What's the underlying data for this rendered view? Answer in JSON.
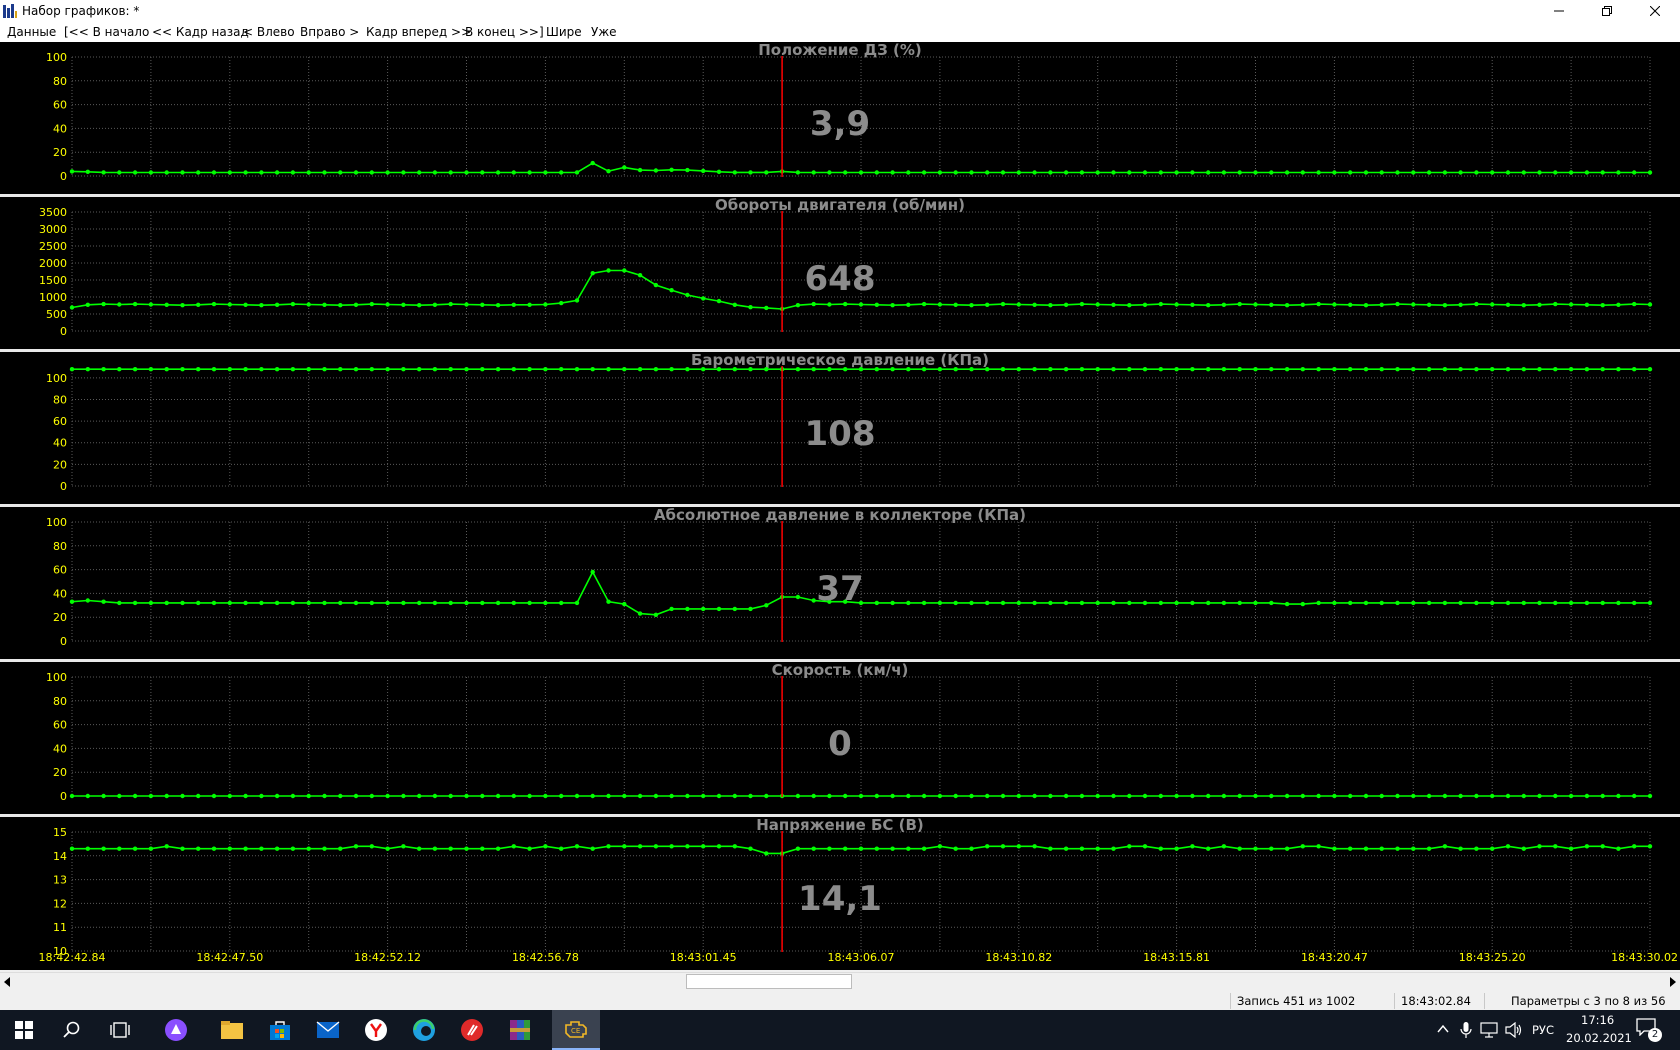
{
  "window": {
    "title": "Набор графиков: *",
    "controls": [
      "minimize",
      "restore",
      "close"
    ]
  },
  "menu": {
    "items": [
      "Данные",
      "[<< В начало",
      "<< Кадр назад",
      "< Влево",
      "Вправо >",
      "Кадр вперед >>",
      "В конец >>]",
      "Шире",
      "Уже"
    ]
  },
  "colors": {
    "background": "#000000",
    "grid": "#5a5a5a",
    "series": "#00ff00",
    "axis_labels": "#ffff00",
    "cursor": "#ff0000",
    "titles": "#8c8c8c",
    "value_readout": "#8c8c8c",
    "separator": "#e8e8e8"
  },
  "cursor_index": 45,
  "chart_data": [
    {
      "type": "line",
      "title": "Положение ДЗ  (%)",
      "current_value": "3,9",
      "ylim": [
        0,
        100
      ],
      "yticks": [
        "0",
        "20",
        "40",
        "60",
        "80",
        "100"
      ],
      "grid": true,
      "x": [
        0,
        1,
        2,
        3,
        4,
        5,
        6,
        7,
        8,
        9,
        10,
        11,
        12,
        13,
        14,
        15,
        16,
        17,
        18,
        19,
        20,
        21,
        22,
        23,
        24,
        25,
        26,
        27,
        28,
        29,
        30,
        31,
        32,
        33,
        34,
        35,
        36,
        37,
        38,
        39,
        40,
        41,
        42,
        43,
        44,
        45,
        46,
        47,
        48,
        49,
        50,
        51,
        52,
        53,
        54,
        55,
        56,
        57,
        58,
        59,
        60,
        61,
        62,
        63,
        64,
        65,
        66,
        67,
        68,
        69,
        70,
        71,
        72,
        73,
        74,
        75,
        76,
        77,
        78,
        79,
        80,
        81,
        82,
        83,
        84,
        85,
        86,
        87,
        88,
        89,
        90,
        91,
        92,
        93,
        94,
        95,
        96,
        97,
        98,
        99,
        100
      ],
      "values": [
        3.9,
        3.5,
        3.0,
        2.9,
        2.9,
        2.9,
        2.9,
        2.9,
        2.9,
        2.9,
        2.9,
        2.9,
        2.9,
        2.9,
        2.9,
        2.9,
        2.9,
        2.9,
        2.9,
        2.9,
        2.9,
        2.9,
        2.9,
        2.9,
        2.9,
        2.9,
        2.9,
        2.9,
        2.9,
        2.9,
        2.9,
        2.9,
        3.0,
        10.8,
        4.0,
        7.2,
        5.0,
        4.6,
        5.2,
        5.0,
        4.3,
        3.5,
        3.0,
        3.0,
        3.0,
        3.9,
        3.0,
        2.9,
        2.9,
        2.9,
        2.9,
        2.9,
        2.9,
        2.9,
        2.9,
        2.9,
        2.9,
        2.9,
        2.9,
        2.9,
        2.9,
        2.9,
        2.9,
        2.9,
        2.9,
        2.9,
        2.9,
        2.9,
        2.9,
        2.9,
        2.9,
        2.9,
        2.9,
        2.9,
        2.9,
        2.9,
        2.9,
        2.9,
        2.9,
        2.9,
        2.9,
        2.9,
        2.9,
        2.9,
        2.9,
        2.9,
        2.9,
        2.9,
        2.9,
        2.9,
        2.9,
        2.9,
        2.9,
        2.9,
        2.9,
        2.9,
        2.9,
        2.9,
        2.9,
        2.9,
        2.9
      ]
    },
    {
      "type": "line",
      "title": "Обороты двигателя  (об/мин)",
      "current_value": "648",
      "ylim": [
        0,
        3500
      ],
      "yticks": [
        "0",
        "500",
        "1000",
        "1500",
        "2000",
        "2500",
        "3000",
        "3500"
      ],
      "grid": true,
      "x": [
        0,
        1,
        2,
        3,
        4,
        5,
        6,
        7,
        8,
        9,
        10,
        11,
        12,
        13,
        14,
        15,
        16,
        17,
        18,
        19,
        20,
        21,
        22,
        23,
        24,
        25,
        26,
        27,
        28,
        29,
        30,
        31,
        32,
        33,
        34,
        35,
        36,
        37,
        38,
        39,
        40,
        41,
        42,
        43,
        44,
        45,
        46,
        47,
        48,
        49,
        50,
        51,
        52,
        53,
        54,
        55,
        56,
        57,
        58,
        59,
        60,
        61,
        62,
        63,
        64,
        65,
        66,
        67,
        68,
        69,
        70,
        71,
        72,
        73,
        74,
        75,
        76,
        77,
        78,
        79,
        80,
        81,
        82,
        83,
        84,
        85,
        86,
        87,
        88,
        89,
        90,
        91,
        92,
        93,
        94,
        95,
        96,
        97,
        98,
        99,
        100
      ],
      "values": [
        690,
        770,
        790,
        780,
        790,
        780,
        770,
        760,
        770,
        790,
        780,
        770,
        760,
        770,
        790,
        780,
        770,
        760,
        770,
        790,
        780,
        770,
        760,
        770,
        790,
        780,
        770,
        760,
        770,
        770,
        780,
        820,
        900,
        1700,
        1780,
        1780,
        1640,
        1350,
        1200,
        1060,
        960,
        880,
        770,
        700,
        680,
        648,
        760,
        790,
        780,
        790,
        780,
        770,
        760,
        770,
        790,
        780,
        770,
        760,
        770,
        790,
        780,
        770,
        760,
        770,
        790,
        780,
        770,
        760,
        770,
        790,
        780,
        770,
        760,
        770,
        790,
        780,
        770,
        760,
        770,
        790,
        780,
        770,
        760,
        770,
        790,
        780,
        770,
        760,
        770,
        790,
        780,
        770,
        760,
        770,
        790,
        780,
        770,
        760,
        770,
        790,
        780
      ]
    },
    {
      "type": "line",
      "title": "Барометрическое давление  (КПа)",
      "current_value": "108",
      "ylim": [
        0,
        110
      ],
      "yticks": [
        "0",
        "20",
        "40",
        "60",
        "80",
        "100"
      ],
      "grid": true,
      "x": [
        0,
        1,
        2,
        3,
        4,
        5,
        6,
        7,
        8,
        9,
        10,
        11,
        12,
        13,
        14,
        15,
        16,
        17,
        18,
        19,
        20,
        21,
        22,
        23,
        24,
        25,
        26,
        27,
        28,
        29,
        30,
        31,
        32,
        33,
        34,
        35,
        36,
        37,
        38,
        39,
        40,
        41,
        42,
        43,
        44,
        45,
        46,
        47,
        48,
        49,
        50,
        51,
        52,
        53,
        54,
        55,
        56,
        57,
        58,
        59,
        60,
        61,
        62,
        63,
        64,
        65,
        66,
        67,
        68,
        69,
        70,
        71,
        72,
        73,
        74,
        75,
        76,
        77,
        78,
        79,
        80,
        81,
        82,
        83,
        84,
        85,
        86,
        87,
        88,
        89,
        90,
        91,
        92,
        93,
        94,
        95,
        96,
        97,
        98,
        99,
        100
      ],
      "values": [
        108,
        108,
        108,
        108,
        108,
        108,
        108,
        108,
        108,
        108,
        108,
        108,
        108,
        108,
        108,
        108,
        108,
        108,
        108,
        108,
        108,
        108,
        108,
        108,
        108,
        108,
        108,
        108,
        108,
        108,
        108,
        108,
        108,
        108,
        108,
        108,
        108,
        108,
        108,
        108,
        108,
        108,
        108,
        108,
        108,
        108,
        108,
        108,
        108,
        108,
        108,
        108,
        108,
        108,
        108,
        108,
        108,
        108,
        108,
        108,
        108,
        108,
        108,
        108,
        108,
        108,
        108,
        108,
        108,
        108,
        108,
        108,
        108,
        108,
        108,
        108,
        108,
        108,
        108,
        108,
        108,
        108,
        108,
        108,
        108,
        108,
        108,
        108,
        108,
        108,
        108,
        108,
        108,
        108,
        108,
        108,
        108,
        108,
        108,
        108,
        108
      ]
    },
    {
      "type": "line",
      "title": "Абсолютное давление в коллекторе  (КПа)",
      "current_value": "37",
      "ylim": [
        0,
        100
      ],
      "yticks": [
        "0",
        "20",
        "40",
        "60",
        "80",
        "100"
      ],
      "grid": true,
      "x": [
        0,
        1,
        2,
        3,
        4,
        5,
        6,
        7,
        8,
        9,
        10,
        11,
        12,
        13,
        14,
        15,
        16,
        17,
        18,
        19,
        20,
        21,
        22,
        23,
        24,
        25,
        26,
        27,
        28,
        29,
        30,
        31,
        32,
        33,
        34,
        35,
        36,
        37,
        38,
        39,
        40,
        41,
        42,
        43,
        44,
        45,
        46,
        47,
        48,
        49,
        50,
        51,
        52,
        53,
        54,
        55,
        56,
        57,
        58,
        59,
        60,
        61,
        62,
        63,
        64,
        65,
        66,
        67,
        68,
        69,
        70,
        71,
        72,
        73,
        74,
        75,
        76,
        77,
        78,
        79,
        80,
        81,
        82,
        83,
        84,
        85,
        86,
        87,
        88,
        89,
        90,
        91,
        92,
        93,
        94,
        95,
        96,
        97,
        98,
        99,
        100
      ],
      "values": [
        33,
        34,
        33,
        32,
        32,
        32,
        32,
        32,
        32,
        32,
        32,
        32,
        32,
        32,
        32,
        32,
        32,
        32,
        32,
        32,
        32,
        32,
        32,
        32,
        32,
        32,
        32,
        32,
        32,
        32,
        32,
        32,
        32,
        58,
        33,
        31,
        23,
        22,
        27,
        27,
        27,
        27,
        27,
        27,
        30,
        37,
        37,
        34,
        33,
        33,
        32,
        32,
        32,
        32,
        32,
        32,
        32,
        32,
        32,
        32,
        32,
        32,
        32,
        32,
        32,
        32,
        32,
        32,
        32,
        32,
        32,
        32,
        32,
        32,
        32,
        32,
        32,
        31,
        31,
        32,
        32,
        32,
        32,
        32,
        32,
        32,
        32,
        32,
        32,
        32,
        32,
        32,
        32,
        32,
        32,
        32,
        32,
        32,
        32,
        32,
        32
      ]
    },
    {
      "type": "line",
      "title": "Скорость  (км/ч)",
      "current_value": "0",
      "ylim": [
        0,
        100
      ],
      "yticks": [
        "0",
        "20",
        "40",
        "60",
        "80",
        "100"
      ],
      "grid": true,
      "x": [
        0,
        1,
        2,
        3,
        4,
        5,
        6,
        7,
        8,
        9,
        10,
        11,
        12,
        13,
        14,
        15,
        16,
        17,
        18,
        19,
        20,
        21,
        22,
        23,
        24,
        25,
        26,
        27,
        28,
        29,
        30,
        31,
        32,
        33,
        34,
        35,
        36,
        37,
        38,
        39,
        40,
        41,
        42,
        43,
        44,
        45,
        46,
        47,
        48,
        49,
        50,
        51,
        52,
        53,
        54,
        55,
        56,
        57,
        58,
        59,
        60,
        61,
        62,
        63,
        64,
        65,
        66,
        67,
        68,
        69,
        70,
        71,
        72,
        73,
        74,
        75,
        76,
        77,
        78,
        79,
        80,
        81,
        82,
        83,
        84,
        85,
        86,
        87,
        88,
        89,
        90,
        91,
        92,
        93,
        94,
        95,
        96,
        97,
        98,
        99,
        100
      ],
      "values": [
        0,
        0,
        0,
        0,
        0,
        0,
        0,
        0,
        0,
        0,
        0,
        0,
        0,
        0,
        0,
        0,
        0,
        0,
        0,
        0,
        0,
        0,
        0,
        0,
        0,
        0,
        0,
        0,
        0,
        0,
        0,
        0,
        0,
        0,
        0,
        0,
        0,
        0,
        0,
        0,
        0,
        0,
        0,
        0,
        0,
        0,
        0,
        0,
        0,
        0,
        0,
        0,
        0,
        0,
        0,
        0,
        0,
        0,
        0,
        0,
        0,
        0,
        0,
        0,
        0,
        0,
        0,
        0,
        0,
        0,
        0,
        0,
        0,
        0,
        0,
        0,
        0,
        0,
        0,
        0,
        0,
        0,
        0,
        0,
        0,
        0,
        0,
        0,
        0,
        0,
        0,
        0,
        0,
        0,
        0,
        0,
        0,
        0,
        0,
        0,
        0
      ]
    },
    {
      "type": "line",
      "title": "Напряжение БС  (В)",
      "current_value": "14,1",
      "ylim": [
        10,
        15
      ],
      "yticks": [
        "10",
        "11",
        "12",
        "13",
        "14",
        "15"
      ],
      "grid": true,
      "x": [
        0,
        1,
        2,
        3,
        4,
        5,
        6,
        7,
        8,
        9,
        10,
        11,
        12,
        13,
        14,
        15,
        16,
        17,
        18,
        19,
        20,
        21,
        22,
        23,
        24,
        25,
        26,
        27,
        28,
        29,
        30,
        31,
        32,
        33,
        34,
        35,
        36,
        37,
        38,
        39,
        40,
        41,
        42,
        43,
        44,
        45,
        46,
        47,
        48,
        49,
        50,
        51,
        52,
        53,
        54,
        55,
        56,
        57,
        58,
        59,
        60,
        61,
        62,
        63,
        64,
        65,
        66,
        67,
        68,
        69,
        70,
        71,
        72,
        73,
        74,
        75,
        76,
        77,
        78,
        79,
        80,
        81,
        82,
        83,
        84,
        85,
        86,
        87,
        88,
        89,
        90,
        91,
        92,
        93,
        94,
        95,
        96,
        97,
        98,
        99,
        100
      ],
      "values": [
        14.3,
        14.3,
        14.3,
        14.3,
        14.3,
        14.3,
        14.4,
        14.3,
        14.3,
        14.3,
        14.3,
        14.3,
        14.3,
        14.3,
        14.3,
        14.3,
        14.3,
        14.3,
        14.4,
        14.4,
        14.3,
        14.4,
        14.3,
        14.3,
        14.3,
        14.3,
        14.3,
        14.3,
        14.4,
        14.3,
        14.4,
        14.3,
        14.4,
        14.3,
        14.4,
        14.4,
        14.4,
        14.4,
        14.4,
        14.4,
        14.4,
        14.4,
        14.4,
        14.3,
        14.1,
        14.1,
        14.3,
        14.3,
        14.3,
        14.3,
        14.3,
        14.3,
        14.3,
        14.3,
        14.3,
        14.4,
        14.3,
        14.3,
        14.4,
        14.4,
        14.4,
        14.4,
        14.3,
        14.3,
        14.3,
        14.3,
        14.3,
        14.4,
        14.4,
        14.3,
        14.3,
        14.4,
        14.3,
        14.4,
        14.3,
        14.3,
        14.3,
        14.3,
        14.4,
        14.4,
        14.3,
        14.3,
        14.3,
        14.3,
        14.3,
        14.3,
        14.3,
        14.4,
        14.3,
        14.3,
        14.3,
        14.4,
        14.3,
        14.4,
        14.4,
        14.3,
        14.4,
        14.4,
        14.3,
        14.4,
        14.4
      ]
    }
  ],
  "x_axis": {
    "tick_labels": [
      "18:42:42.84",
      "18:42:47.50",
      "18:42:52.12",
      "18:42:56.78",
      "18:43:01.45",
      "18:43:06.07",
      "18:43:10.82",
      "18:43:15.81",
      "18:43:20.47",
      "18:43:25.20",
      "18:43:30.02"
    ]
  },
  "statusbar": {
    "record": "Запись 451 из 1002",
    "time": "18:43:02.84",
    "params": "Параметры с 3 по 8 из 56"
  },
  "taskbar": {
    "icons": [
      "windows-start",
      "search",
      "task-view",
      "alice",
      "file-explorer",
      "store",
      "mail",
      "yandex-browser",
      "edge",
      "opera",
      "winrar",
      "obd-app"
    ],
    "language": "РУС",
    "time": "17:16",
    "date": "20.02.2021",
    "notifications": "2"
  }
}
